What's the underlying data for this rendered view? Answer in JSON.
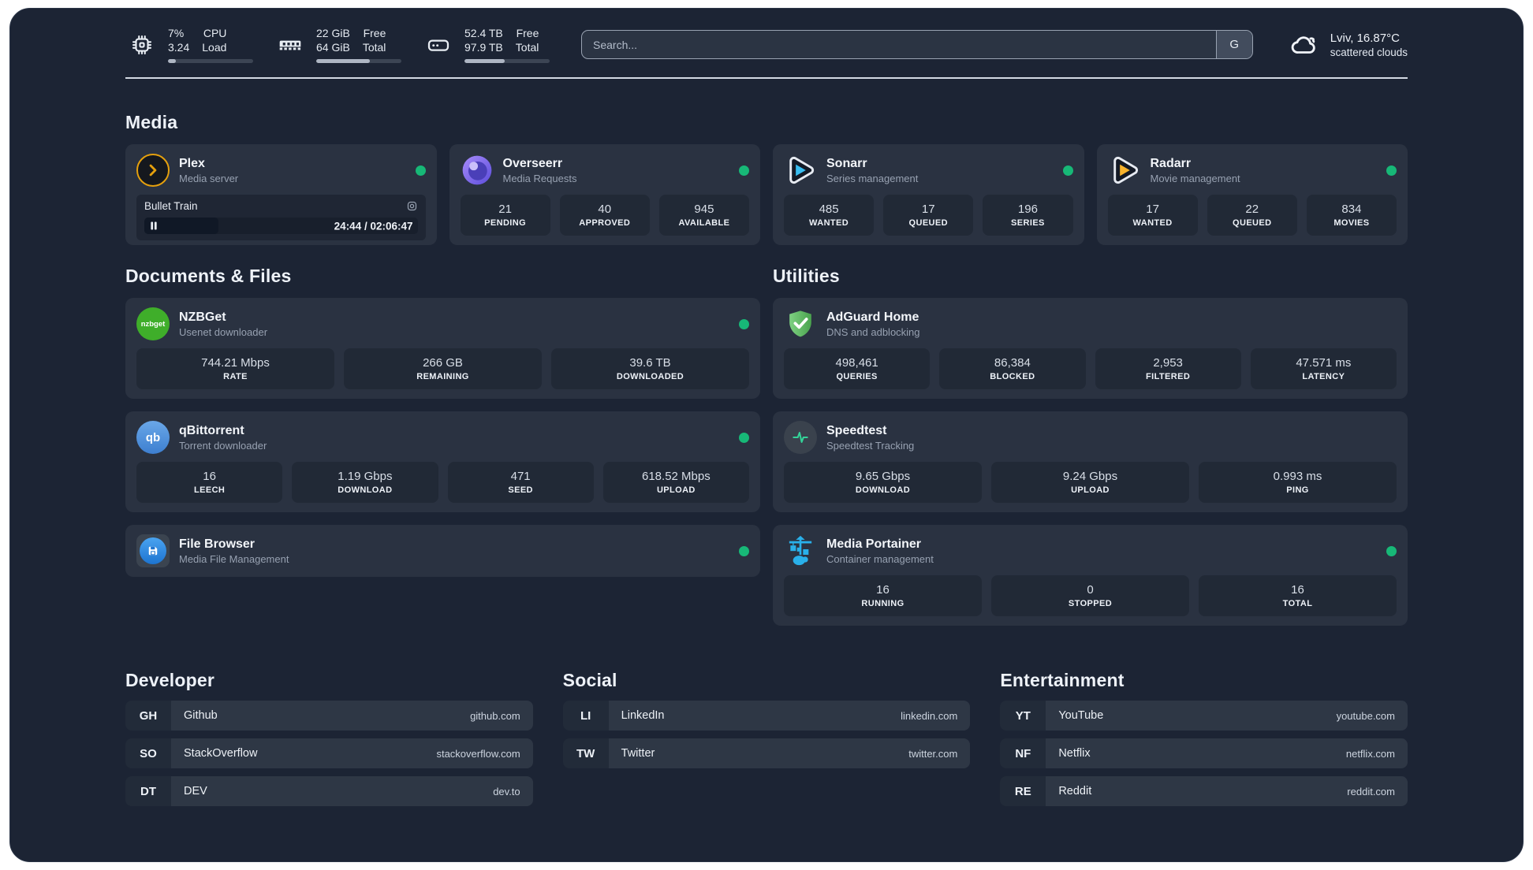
{
  "header": {
    "system_stats": [
      {
        "icon": "cpu-icon",
        "value_top": "7%",
        "value_bottom": "3.24",
        "label_top": "CPU",
        "label_bottom": "Load",
        "progress": "9%"
      },
      {
        "icon": "memory-icon",
        "value_top": "22 GiB",
        "value_bottom": "64 GiB",
        "label_top": "Free",
        "label_bottom": "Total",
        "progress": "63%"
      },
      {
        "icon": "storage-icon",
        "value_top": "52.4 TB",
        "value_bottom": "97.9 TB",
        "label_top": "Free",
        "label_bottom": "Total",
        "progress": "47%"
      }
    ],
    "search": {
      "placeholder": "Search...",
      "engine_button": "G"
    },
    "weather": {
      "location": "Lviv, 16.87°C",
      "condition": "scattered clouds"
    }
  },
  "sections": {
    "media": {
      "title": "Media",
      "cards": [
        {
          "name": "Plex",
          "desc": "Media server",
          "status": "online",
          "now_playing": {
            "title": "Bullet Train",
            "time": "24:44 / 02:06:47",
            "progress": "27%"
          }
        },
        {
          "name": "Overseerr",
          "desc": "Media Requests",
          "status": "online",
          "stats": [
            {
              "value": "21",
              "label": "PENDING"
            },
            {
              "value": "40",
              "label": "APPROVED"
            },
            {
              "value": "945",
              "label": "AVAILABLE"
            }
          ]
        },
        {
          "name": "Sonarr",
          "desc": "Series management",
          "status": "online",
          "stats": [
            {
              "value": "485",
              "label": "WANTED"
            },
            {
              "value": "17",
              "label": "QUEUED"
            },
            {
              "value": "196",
              "label": "SERIES"
            }
          ]
        },
        {
          "name": "Radarr",
          "desc": "Movie management",
          "status": "online",
          "stats": [
            {
              "value": "17",
              "label": "WANTED"
            },
            {
              "value": "22",
              "label": "QUEUED"
            },
            {
              "value": "834",
              "label": "MOVIES"
            }
          ]
        }
      ]
    },
    "documents": {
      "title": "Documents & Files",
      "cards": [
        {
          "name": "NZBGet",
          "desc": "Usenet downloader",
          "status": "online",
          "icon_text": "nzbget",
          "stats": [
            {
              "value": "744.21 Mbps",
              "label": "RATE"
            },
            {
              "value": "266 GB",
              "label": "REMAINING"
            },
            {
              "value": "39.6 TB",
              "label": "DOWNLOADED"
            }
          ]
        },
        {
          "name": "qBittorrent",
          "desc": "Torrent downloader",
          "status": "online",
          "icon_text": "qb",
          "stats": [
            {
              "value": "16",
              "label": "LEECH"
            },
            {
              "value": "1.19 Gbps",
              "label": "DOWNLOAD"
            },
            {
              "value": "471",
              "label": "SEED"
            },
            {
              "value": "618.52 Mbps",
              "label": "UPLOAD"
            }
          ]
        },
        {
          "name": "File Browser",
          "desc": "Media File Management",
          "status": "online",
          "stats": []
        }
      ]
    },
    "utilities": {
      "title": "Utilities",
      "cards": [
        {
          "name": "AdGuard Home",
          "desc": "DNS and adblocking",
          "stats": [
            {
              "value": "498,461",
              "label": "QUERIES"
            },
            {
              "value": "86,384",
              "label": "BLOCKED"
            },
            {
              "value": "2,953",
              "label": "FILTERED"
            },
            {
              "value": "47.571 ms",
              "label": "LATENCY"
            }
          ]
        },
        {
          "name": "Speedtest",
          "desc": "Speedtest Tracking",
          "stats": [
            {
              "value": "9.65 Gbps",
              "label": "DOWNLOAD"
            },
            {
              "value": "9.24 Gbps",
              "label": "UPLOAD"
            },
            {
              "value": "0.993 ms",
              "label": "PING"
            }
          ]
        },
        {
          "name": "Media Portainer",
          "desc": "Container management",
          "status": "online",
          "stats": [
            {
              "value": "16",
              "label": "RUNNING"
            },
            {
              "value": "0",
              "label": "STOPPED"
            },
            {
              "value": "16",
              "label": "TOTAL"
            }
          ]
        }
      ]
    },
    "developer": {
      "title": "Developer",
      "links": [
        {
          "abbr": "GH",
          "name": "Github",
          "domain": "github.com"
        },
        {
          "abbr": "SO",
          "name": "StackOverflow",
          "domain": "stackoverflow.com"
        },
        {
          "abbr": "DT",
          "name": "DEV",
          "domain": "dev.to"
        }
      ]
    },
    "social": {
      "title": "Social",
      "links": [
        {
          "abbr": "LI",
          "name": "LinkedIn",
          "domain": "linkedin.com"
        },
        {
          "abbr": "TW",
          "name": "Twitter",
          "domain": "twitter.com"
        }
      ]
    },
    "entertainment": {
      "title": "Entertainment",
      "links": [
        {
          "abbr": "YT",
          "name": "YouTube",
          "domain": "youtube.com"
        },
        {
          "abbr": "NF",
          "name": "Netflix",
          "domain": "netflix.com"
        },
        {
          "abbr": "RE",
          "name": "Reddit",
          "domain": "reddit.com"
        }
      ]
    }
  },
  "colors": {
    "status_online": "#17b877",
    "plex_accent": "#e5a00d",
    "sonarr_accent": "#38bdf0",
    "radarr_accent": "#f9b42d",
    "nzbget_accent": "#3fae2a",
    "qbittorrent_accent": "#4b8fd4",
    "adguard_accent": "#5cb85c",
    "speedtest_accent": "#34d399",
    "portainer_accent": "#29b0ea",
    "filebrowser_accent": "#2086e7",
    "dashboard_bg": "#1c2434",
    "card_bg": "#2a3241"
  }
}
